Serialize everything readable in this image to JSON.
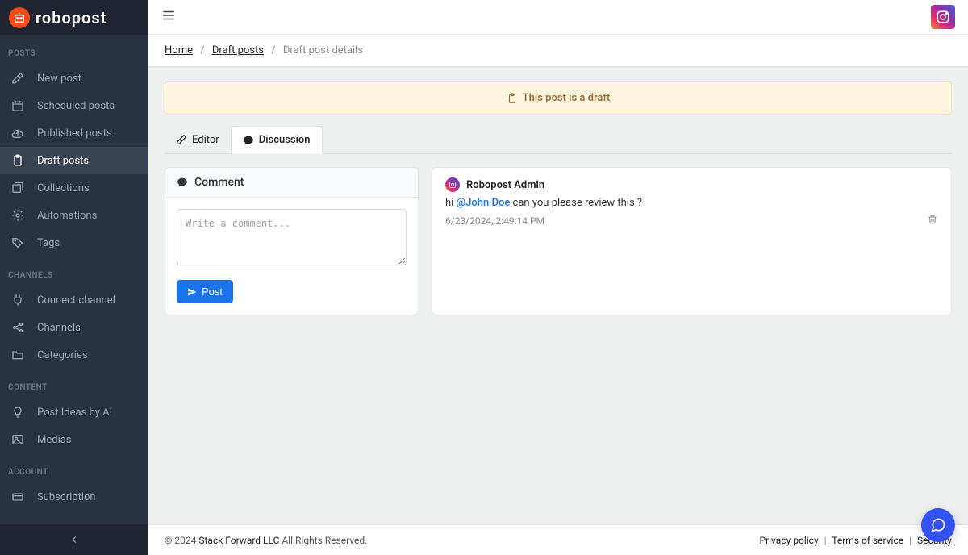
{
  "brand": "robopost",
  "sidebar": {
    "sections": [
      {
        "heading": "POSTS",
        "items": [
          {
            "label": "New post",
            "name": "new-post"
          },
          {
            "label": "Scheduled posts",
            "name": "scheduled-posts"
          },
          {
            "label": "Published posts",
            "name": "published-posts"
          },
          {
            "label": "Draft posts",
            "name": "draft-posts",
            "active": true
          },
          {
            "label": "Collections",
            "name": "collections"
          },
          {
            "label": "Automations",
            "name": "automations"
          },
          {
            "label": "Tags",
            "name": "tags"
          }
        ]
      },
      {
        "heading": "CHANNELS",
        "items": [
          {
            "label": "Connect channel",
            "name": "connect-channel"
          },
          {
            "label": "Channels",
            "name": "channels"
          },
          {
            "label": "Categories",
            "name": "categories"
          }
        ]
      },
      {
        "heading": "CONTENT",
        "items": [
          {
            "label": "Post Ideas by AI",
            "name": "post-ideas"
          },
          {
            "label": "Medias",
            "name": "medias"
          }
        ]
      },
      {
        "heading": "ACCOUNT",
        "items": [
          {
            "label": "Subscription",
            "name": "subscription"
          }
        ]
      }
    ]
  },
  "breadcrumb": {
    "home": "Home",
    "parent": "Draft posts",
    "current": "Draft post details"
  },
  "banner": "This post is a draft",
  "tabs": {
    "editor": "Editor",
    "discussion": "Discussion"
  },
  "commentPanel": {
    "title": "Comment",
    "placeholder": "Write a comment...",
    "postLabel": "Post"
  },
  "thread": {
    "author": "Robopost Admin",
    "prefix": "hi ",
    "mention": "@John Doe",
    "suffix": " can you please review this ?",
    "timestamp": "6/23/2024, 2:49:14 PM"
  },
  "footer": {
    "copyright": "©  2024 ",
    "company": "Stack Forward LLC",
    "rights": "  All Rights Reserved.",
    "privacy": "Privacy policy",
    "terms": "Terms of service",
    "security": "Security"
  }
}
